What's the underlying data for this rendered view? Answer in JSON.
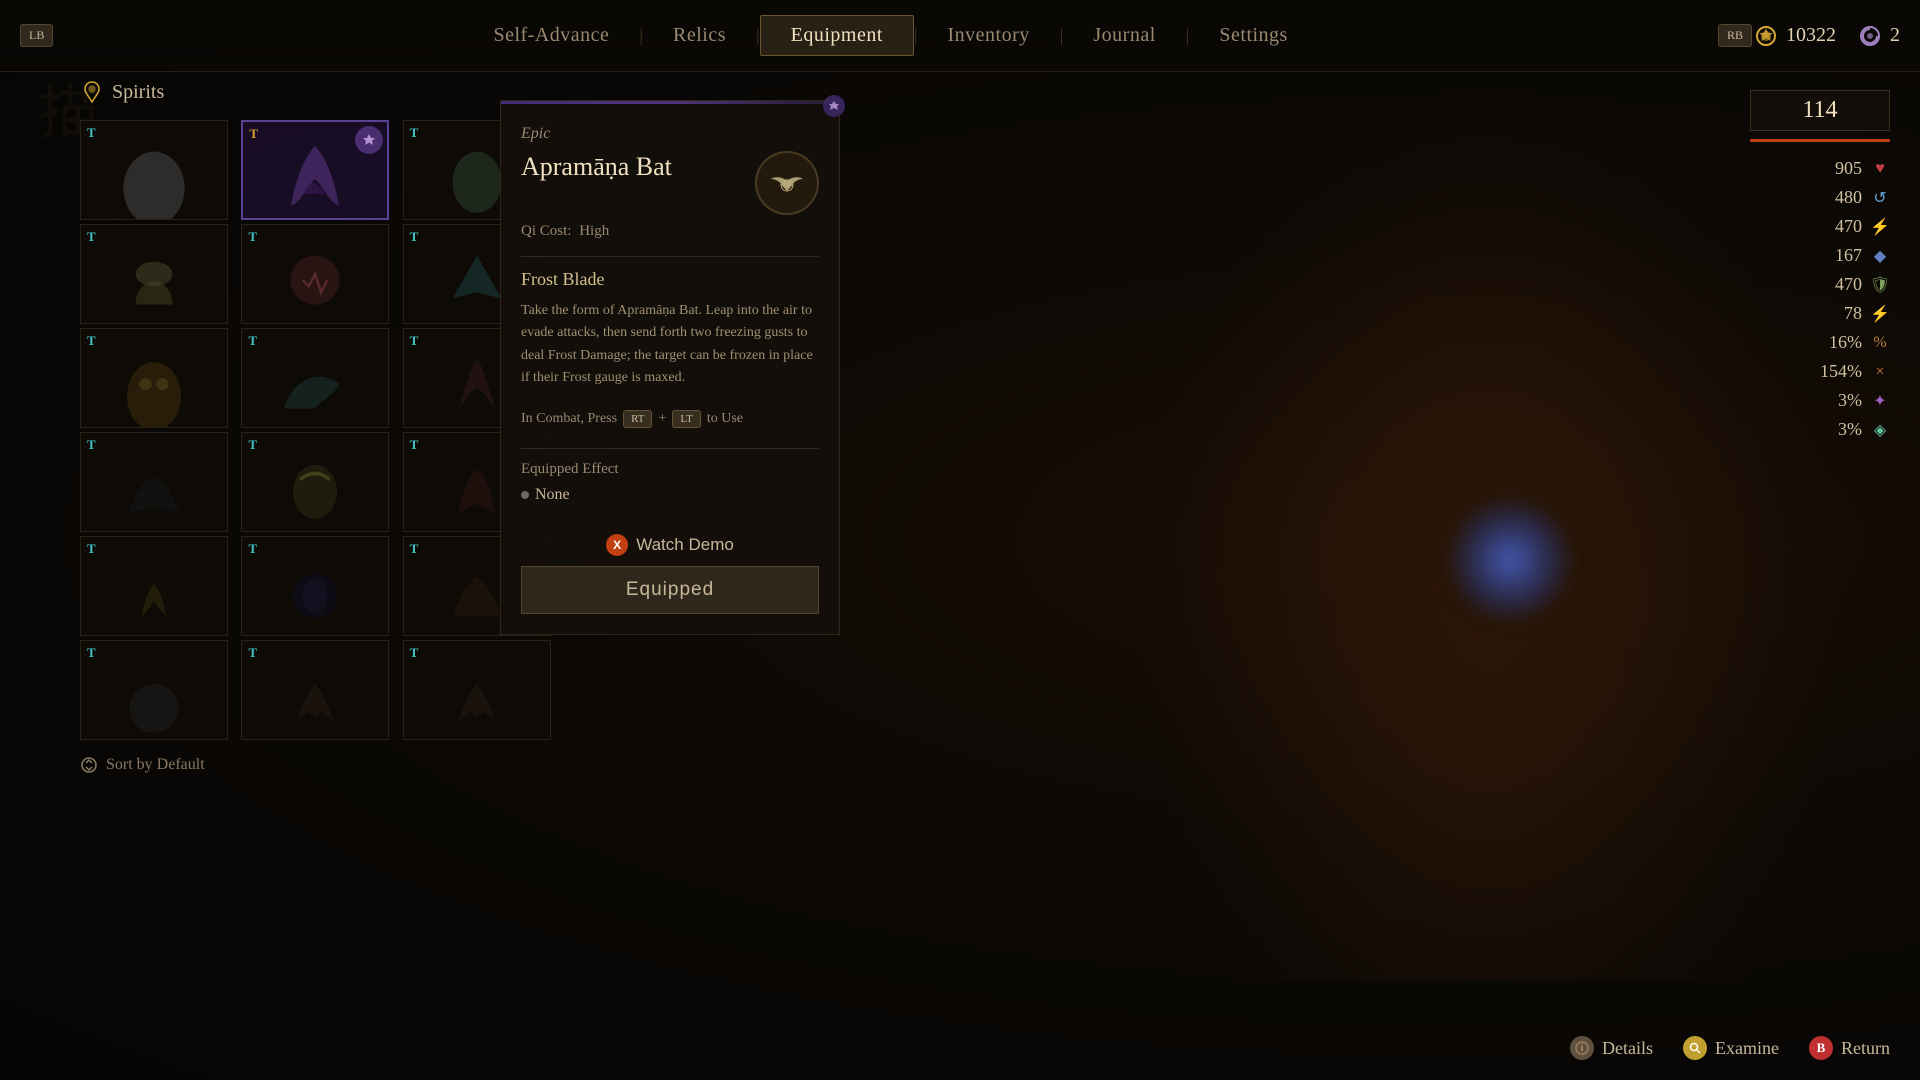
{
  "nav": {
    "lb_label": "LB",
    "rb_label": "RB",
    "items": [
      {
        "id": "self-advance",
        "label": "Self-Advance",
        "active": false
      },
      {
        "id": "relics",
        "label": "Relics",
        "active": false
      },
      {
        "id": "equipment",
        "label": "Equipment",
        "active": true
      },
      {
        "id": "inventory",
        "label": "Inventory",
        "active": false
      },
      {
        "id": "journal",
        "label": "Journal",
        "active": false
      },
      {
        "id": "settings",
        "label": "Settings",
        "active": false
      }
    ],
    "currency1_value": "10322",
    "currency2_value": "2"
  },
  "spirits": {
    "header": "Spirits",
    "grid": [
      {
        "id": 1,
        "tier": "T",
        "tier_color": "teal",
        "has_badge": false,
        "style": "spirit-img-1"
      },
      {
        "id": 2,
        "tier": "T",
        "tier_color": "orange",
        "has_badge": true,
        "style": "spirit-img-2",
        "selected": true
      },
      {
        "id": 3,
        "tier": "T",
        "tier_color": "teal",
        "has_badge": false,
        "style": "spirit-img-3"
      },
      {
        "id": 4,
        "tier": "T",
        "tier_color": "teal",
        "has_badge": false,
        "style": "spirit-img-4"
      },
      {
        "id": 5,
        "tier": "T",
        "tier_color": "teal",
        "has_badge": false,
        "style": "spirit-img-5"
      },
      {
        "id": 6,
        "tier": "T",
        "tier_color": "teal",
        "has_badge": false,
        "style": "spirit-img-6"
      },
      {
        "id": 7,
        "tier": "T",
        "tier_color": "teal",
        "has_badge": false,
        "style": "spirit-img-7"
      },
      {
        "id": 8,
        "tier": "T",
        "tier_color": "teal",
        "has_badge": false,
        "style": "spirit-img-8"
      },
      {
        "id": 9,
        "tier": "T",
        "tier_color": "teal",
        "has_badge": false,
        "style": "spirit-img-9"
      },
      {
        "id": 10,
        "tier": "T",
        "tier_color": "teal",
        "has_badge": false,
        "style": "spirit-img-10"
      },
      {
        "id": 11,
        "tier": "T",
        "tier_color": "teal",
        "has_badge": false,
        "style": "spirit-img-11"
      },
      {
        "id": 12,
        "tier": "T",
        "tier_color": "teal",
        "has_badge": false,
        "style": "spirit-img-12"
      },
      {
        "id": 13,
        "tier": "T",
        "tier_color": "teal",
        "has_badge": false,
        "style": "spirit-img-13"
      },
      {
        "id": 14,
        "tier": "T",
        "tier_color": "teal",
        "has_badge": false,
        "style": "spirit-img-14"
      },
      {
        "id": 15,
        "tier": "T",
        "tier_color": "teal",
        "has_badge": false,
        "style": "spirit-img-15"
      },
      {
        "id": 16,
        "tier": "T",
        "tier_color": "teal",
        "has_badge": false,
        "style": "spirit-img-16"
      },
      {
        "id": 17,
        "tier": "T",
        "tier_color": "teal",
        "has_badge": false,
        "style": "spirit-img-17"
      },
      {
        "id": 18,
        "tier": "T",
        "tier_color": "teal",
        "has_badge": false,
        "style": "spirit-img-18"
      }
    ],
    "sort_label": "Sort by Default"
  },
  "item": {
    "rarity": "Epic",
    "name": "Apramāṇa Bat",
    "qi_cost_label": "Qi Cost:",
    "qi_cost_value": "High",
    "skill_name": "Frost Blade",
    "skill_desc": "Take the form of Apramāṇa Bat. Leap into the air to evade attacks, then send forth two freezing gusts to deal Frost Damage; the target can be frozen in place if their Frost gauge is maxed.",
    "combat_prefix": "In Combat, Press",
    "combat_btn1": "RT",
    "combat_plus": "+",
    "combat_btn2": "LT",
    "combat_suffix": "to Use",
    "equipped_effect_label": "Equipped Effect",
    "equipped_effect_value": "None",
    "watch_demo_label": "Watch Demo",
    "equipped_btn_label": "Equipped"
  },
  "stats": {
    "level": "114",
    "values": [
      {
        "icon": "♥",
        "icon_class": "heart",
        "value": "905"
      },
      {
        "icon": "⟳",
        "icon_class": "shield",
        "value": "480"
      },
      {
        "icon": "⚡",
        "icon_class": "bolt",
        "value": "470"
      },
      {
        "icon": "◆",
        "icon_class": "drop",
        "value": "167"
      },
      {
        "icon": "🛡",
        "icon_class": "armor",
        "value": "470"
      },
      {
        "icon": "⚡",
        "icon_class": "speed",
        "value": "78"
      },
      {
        "icon": "%",
        "icon_class": "percent",
        "value": "16%"
      },
      {
        "icon": "×",
        "icon_class": "mult",
        "value": "154%"
      },
      {
        "icon": "✦",
        "icon_class": "magic",
        "value": "3%"
      },
      {
        "icon": "◈",
        "icon_class": "gem",
        "value": "3%"
      }
    ]
  },
  "bottom_nav": {
    "details_label": "Details",
    "examine_label": "Examine",
    "return_label": "Return"
  },
  "deco_char": "描"
}
